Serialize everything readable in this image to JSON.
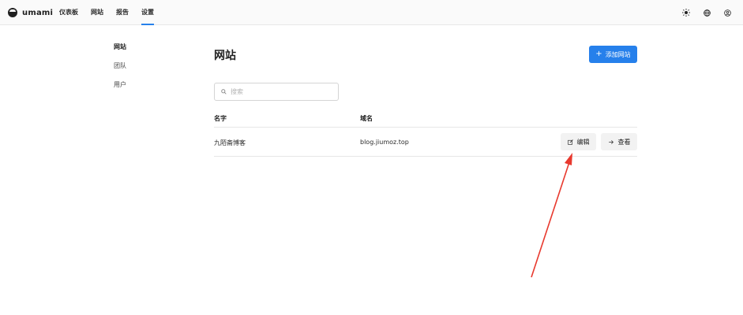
{
  "app": {
    "name": "umami"
  },
  "nav": [
    {
      "label": "仪表板"
    },
    {
      "label": "网站"
    },
    {
      "label": "报告"
    },
    {
      "label": "设置"
    }
  ],
  "top_icons": [
    "sun-icon",
    "globe-icon",
    "user-icon"
  ],
  "sidebar": {
    "items": [
      {
        "label": "网站"
      },
      {
        "label": "团队"
      },
      {
        "label": "用户"
      }
    ]
  },
  "main": {
    "title": "网站",
    "add_button_label": "添加网站",
    "search": {
      "placeholder": "搜索",
      "value": ""
    },
    "table": {
      "columns": [
        "名字",
        "域名"
      ],
      "rows": [
        {
          "name": "九陌斋博客",
          "domain": "blog.jiumoz.top",
          "edit_label": "编辑",
          "view_label": "查看"
        }
      ]
    }
  },
  "colors": {
    "accent": "#2680eb",
    "annotation_arrow": "#e8392e"
  }
}
